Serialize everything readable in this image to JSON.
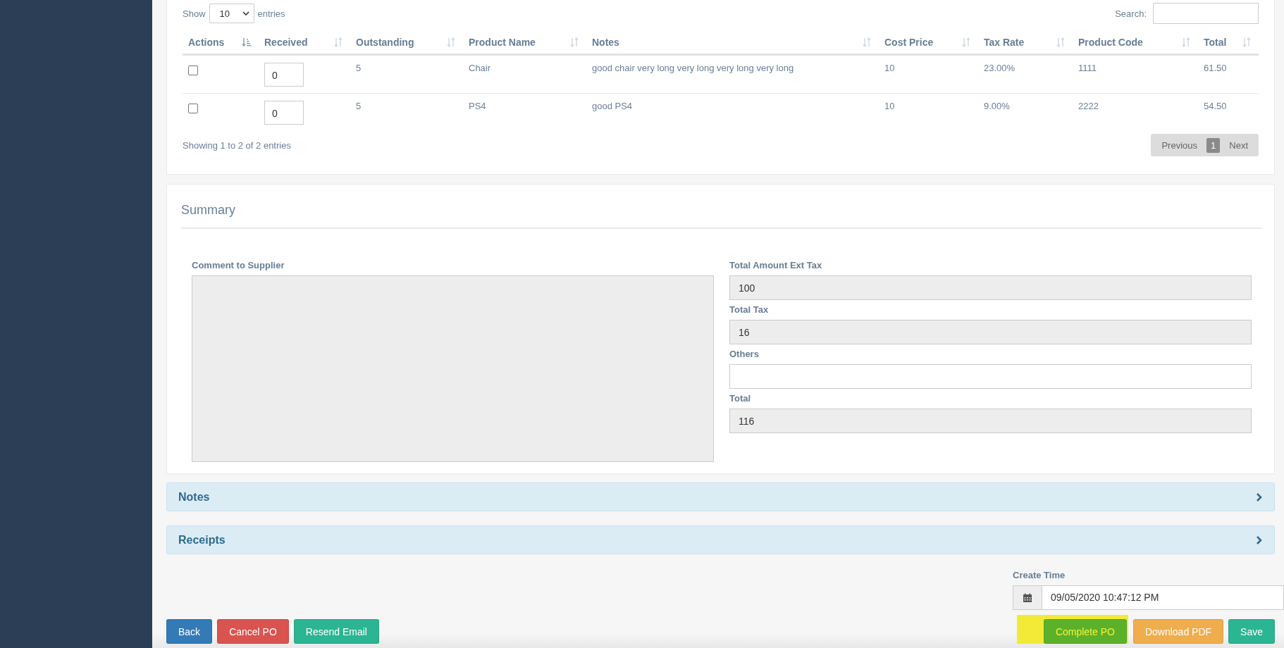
{
  "table_panel": {
    "length_label_before": "Show",
    "length_value": "10",
    "length_label_after": "entries",
    "search_label": "Search:",
    "columns": [
      {
        "label": "Actions",
        "sorted": true
      },
      {
        "label": "Received",
        "sorted": false
      },
      {
        "label": "Outstanding",
        "sorted": false
      },
      {
        "label": "Product Name",
        "sorted": false
      },
      {
        "label": "Notes",
        "sorted": false
      },
      {
        "label": "Cost Price",
        "sorted": false
      },
      {
        "label": "Tax Rate",
        "sorted": false
      },
      {
        "label": "Product Code",
        "sorted": false
      },
      {
        "label": "Total",
        "sorted": false
      }
    ],
    "rows": [
      {
        "checked": false,
        "received": "0",
        "outstanding": "5",
        "product_name": "Chair",
        "notes": "good chair very long very long very long very long",
        "cost_price": "10",
        "tax_rate": "23.00%",
        "product_code": "1111",
        "total": "61.50"
      },
      {
        "checked": false,
        "received": "0",
        "outstanding": "5",
        "product_name": "PS4",
        "notes": "good PS4",
        "cost_price": "10",
        "tax_rate": "9.00%",
        "product_code": "2222",
        "total": "54.50"
      }
    ],
    "info": "Showing 1 to 2 of 2 entries",
    "pagination": [
      {
        "label": "Previous",
        "selected": false
      },
      {
        "label": "1",
        "selected": true
      },
      {
        "label": "Next",
        "selected": false
      }
    ]
  },
  "summary": {
    "title": "Summary",
    "comment_label": "Comment to Supplier",
    "fields": [
      {
        "label": "Total Amount Ext Tax",
        "value": "100",
        "readonly": true
      },
      {
        "label": "Total Tax",
        "value": "16",
        "readonly": true
      },
      {
        "label": "Others",
        "readonly": false
      },
      {
        "label": "Total",
        "value": "116",
        "readonly": true
      }
    ]
  },
  "collapsibles": [
    {
      "title": "Notes",
      "expanded": false
    },
    {
      "title": "Receipts",
      "expanded": false
    }
  ],
  "create_time": {
    "label": "Create Time",
    "value": "09/05/2020 10:47:12 PM"
  },
  "left_buttons": [
    {
      "label": "Back",
      "kind": "primary",
      "highlighted": false
    },
    {
      "label": "Cancel PO",
      "kind": "danger",
      "highlighted": false
    },
    {
      "label": "Resend Email",
      "kind": "teal",
      "highlighted": false
    }
  ],
  "right_buttons": [
    {
      "label": "Complete PO",
      "kind": "success",
      "highlighted": true
    },
    {
      "label": "Download PDF",
      "kind": "warning",
      "highlighted": false
    },
    {
      "label": "Save",
      "kind": "teal",
      "highlighted": false
    }
  ]
}
